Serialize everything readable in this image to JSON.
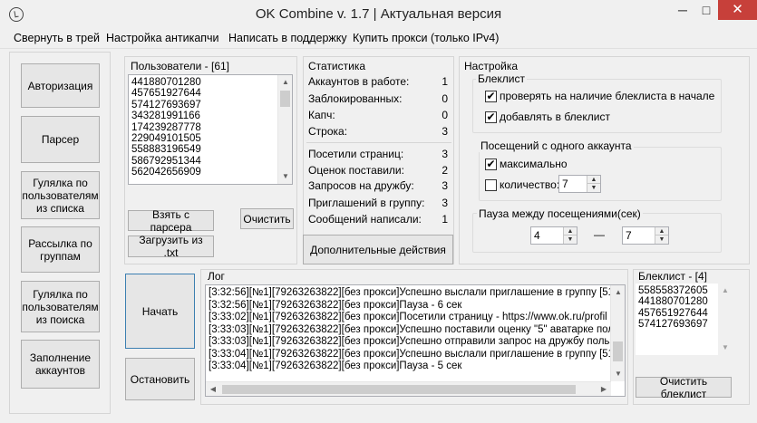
{
  "window": {
    "title": "OK Combine v. 1.7 | Актуальная версия",
    "minimize": "─",
    "maximize": "□",
    "close": "✕"
  },
  "menu": [
    "Свернуть в трей",
    "Настройка антикапчи",
    "Написать в поддержку",
    "Купить прокси (только IPv4)"
  ],
  "sidebar": [
    "Авторизация",
    "Парсер",
    "Гулялка по пользователям из списка",
    "Рассылка по группам",
    "Гулялка по пользователям из поиска",
    "Заполнение аккаунтов"
  ],
  "users": {
    "label": "Пользователи - [61]",
    "items": [
      "441880701280",
      "457651927644",
      "574127693697",
      "343281991166",
      "174239287778",
      "229049101505",
      "558883196549",
      "586792951344",
      "562042656909"
    ],
    "take_button": "Взять с парсера",
    "clear_button": "Очистить",
    "load_button": "Загрузить из .txt"
  },
  "stats": {
    "label": "Статистика",
    "rows": [
      {
        "label": "Аккаунтов в работе:",
        "value": "1"
      },
      {
        "label": "Заблокированных:",
        "value": "0"
      },
      {
        "label": "Капч:",
        "value": "0"
      },
      {
        "label": "Строка:",
        "value": "3"
      },
      {
        "label": "Посетили страниц:",
        "value": "3"
      },
      {
        "label": "Оценок поставили:",
        "value": "2"
      },
      {
        "label": "Запросов на дружбу:",
        "value": "3"
      },
      {
        "label": "Приглашений в группу:",
        "value": "3"
      },
      {
        "label": "Сообщений написали:",
        "value": "1"
      }
    ],
    "extra_button": "Дополнительные действия"
  },
  "settings": {
    "label": "Настройка",
    "blacklist_group": "Блеклист",
    "check_blacklist": "проверять на наличие блеклиста в начале",
    "add_blacklist": "добавлять в блеклист",
    "visits_group": "Посещений с одного аккаунта",
    "max_label": "максимально",
    "count_label": "количество:",
    "count_value": "7",
    "pause_group": "Пауза между посещениями(сек)",
    "pause_from": "4",
    "pause_dash": "—",
    "pause_to": "7",
    "check_mark": "✔"
  },
  "controls": {
    "start": "Начать",
    "stop": "Остановить"
  },
  "log": {
    "label": "Лог",
    "lines": [
      "[3:32:56][№1][79263263822][без прокси]Успешно выслали приглашение в группу [51",
      "[3:32:56][№1][79263263822][без прокси]Пауза - 6 сек",
      "[3:33:02][№1][79263263822][без прокси]Посетили страницу - https://www.ok.ru/profil",
      "[3:33:03][№1][79263263822][без прокси]Успешно поставили оценку \"5\" аватарке пол",
      "[3:33:03][№1][79263263822][без прокси]Успешно отправили запрос на дружбу польз",
      "[3:33:04][№1][79263263822][без прокси]Успешно выслали приглашение в группу [51",
      "[3:33:04][№1][79263263822][без прокси]Пауза - 5 сек"
    ]
  },
  "blacklist": {
    "label": "Блеклист - [4]",
    "items": [
      "558558372605",
      "441880701280",
      "457651927644",
      "574127693697"
    ],
    "clear_button": "Очистить блеклист"
  },
  "scroll_arrows": {
    "up": "▲",
    "down": "▼",
    "left": "◀",
    "right": "▶"
  }
}
